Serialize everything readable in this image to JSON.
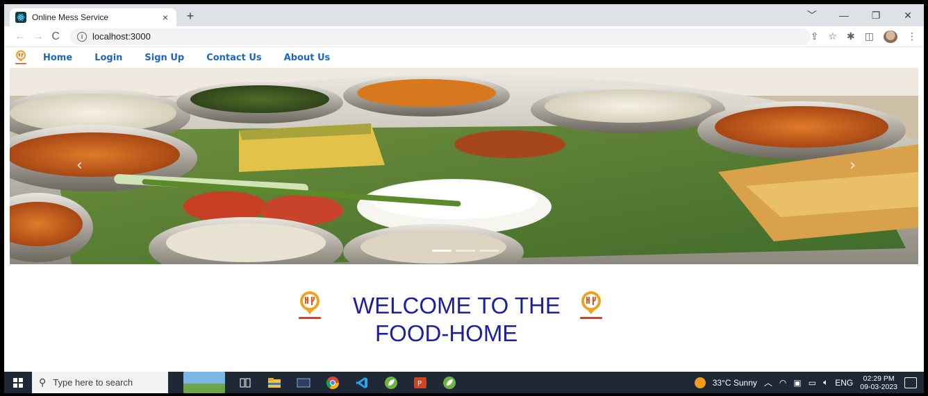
{
  "browser": {
    "tab_title": "Online Mess Service",
    "tab_close": "×",
    "new_tab": "+",
    "url": "localhost:3000",
    "window_controls": [
      "﹀",
      "—",
      "❐",
      "✕"
    ]
  },
  "site": {
    "nav": [
      {
        "label": "Home"
      },
      {
        "label": "Login"
      },
      {
        "label": "Sign Up"
      },
      {
        "label": "Contact Us"
      },
      {
        "label": "About Us"
      }
    ],
    "carousel": {
      "prev": "‹",
      "next": "›",
      "indicator_count": 3,
      "active_index": 0
    },
    "welcome_line1": "WELCOME TO THE",
    "welcome_line2": "FOOD-HOME"
  },
  "taskbar": {
    "search_placeholder": "Type here to search",
    "weather": "33°C  Sunny",
    "language": "ENG",
    "time": "02:29 PM",
    "date": "09-03-2023",
    "notification_count": "1"
  },
  "colors": {
    "nav_link": "#1a66c9",
    "welcome_text": "#1b1fa0",
    "taskbar": "#1f2836"
  }
}
